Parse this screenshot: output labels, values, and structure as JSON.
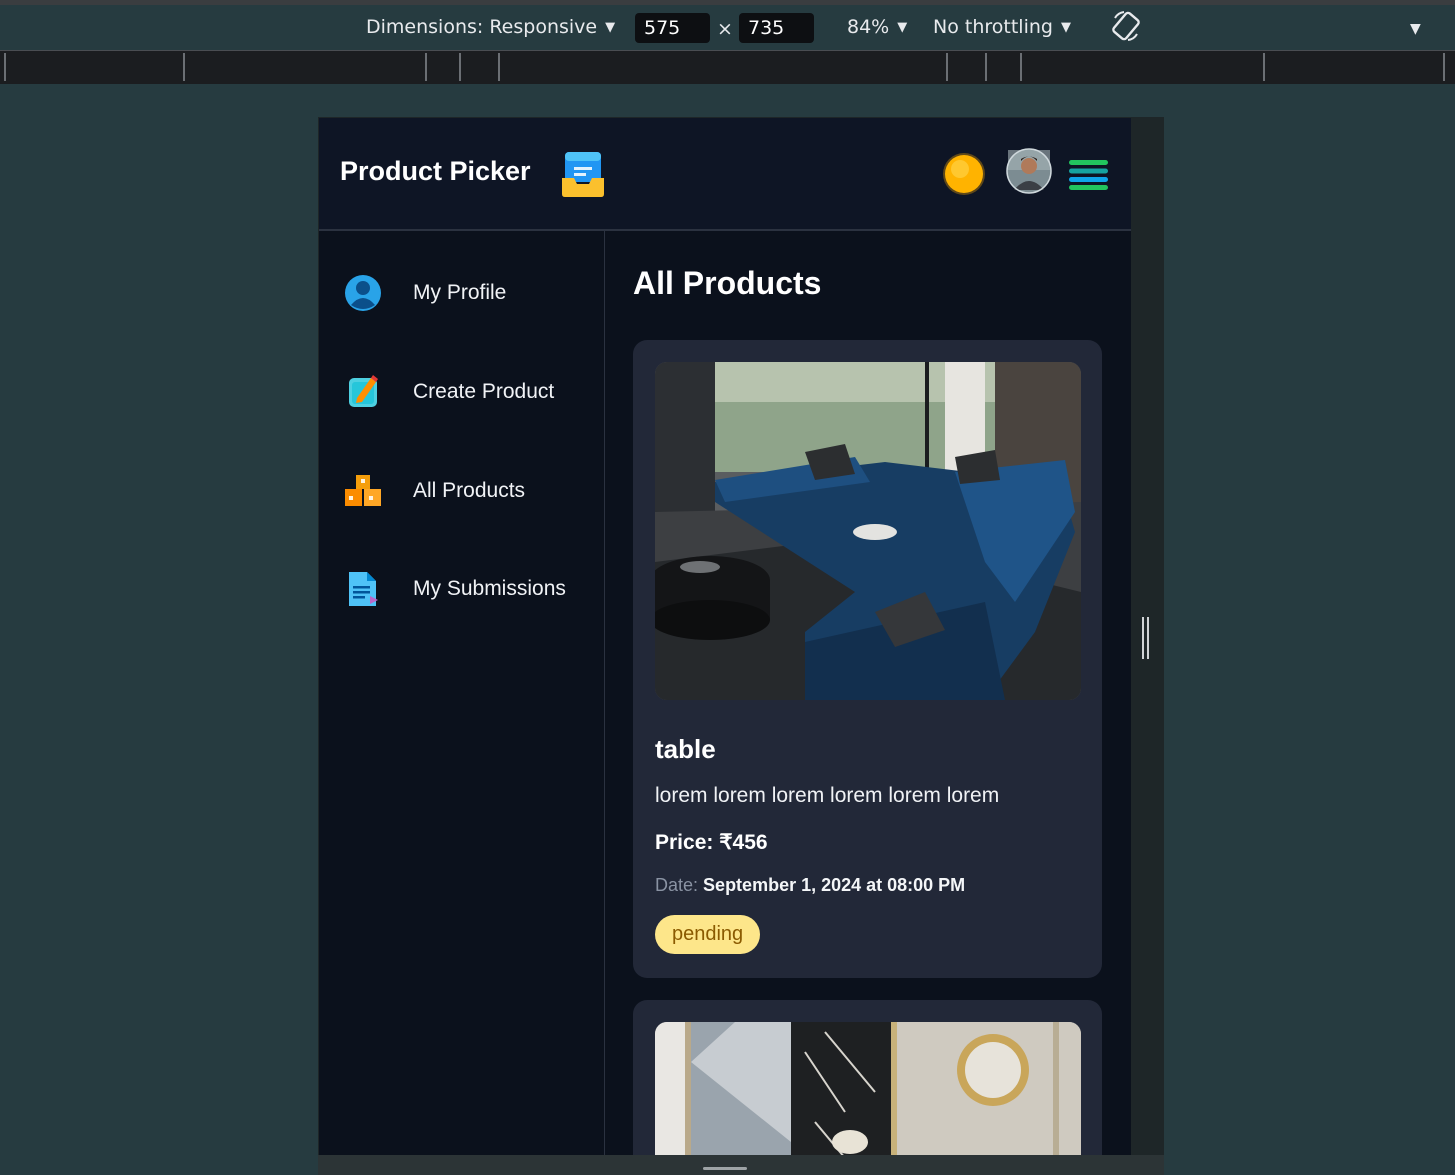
{
  "devtools": {
    "dimensions_label": "Dimensions: Responsive",
    "width": "575",
    "times": "×",
    "height": "735",
    "zoom": "84%",
    "throttling": "No throttling"
  },
  "app": {
    "title": "Product Picker",
    "logo_icon": "inbox-tray-icon",
    "theme_icon": "sun-icon",
    "avatar_icon": "user-avatar",
    "menu_icon": "hamburger-menu-icon"
  },
  "sidebar": {
    "items": [
      {
        "label": "My Profile",
        "icon": "user-icon"
      },
      {
        "label": "Create Product",
        "icon": "memo-pencil-icon"
      },
      {
        "label": "All Products",
        "icon": "boxes-icon"
      },
      {
        "label": "My Submissions",
        "icon": "document-icon"
      }
    ]
  },
  "main": {
    "title": "All Products",
    "cards": [
      {
        "name": "table",
        "description": "lorem lorem lorem lorem lorem lorem",
        "price_label": "Price: ₹456",
        "date_label": "Date:",
        "date_value": "September 1, 2024 at 08:00 PM",
        "status": "pending"
      }
    ]
  },
  "colors": {
    "navbar_bg": "#0e1525",
    "page_bg": "#0b111c",
    "card_bg": "#222838",
    "badge_bg": "#fde68a",
    "badge_text": "#8a5a00"
  }
}
